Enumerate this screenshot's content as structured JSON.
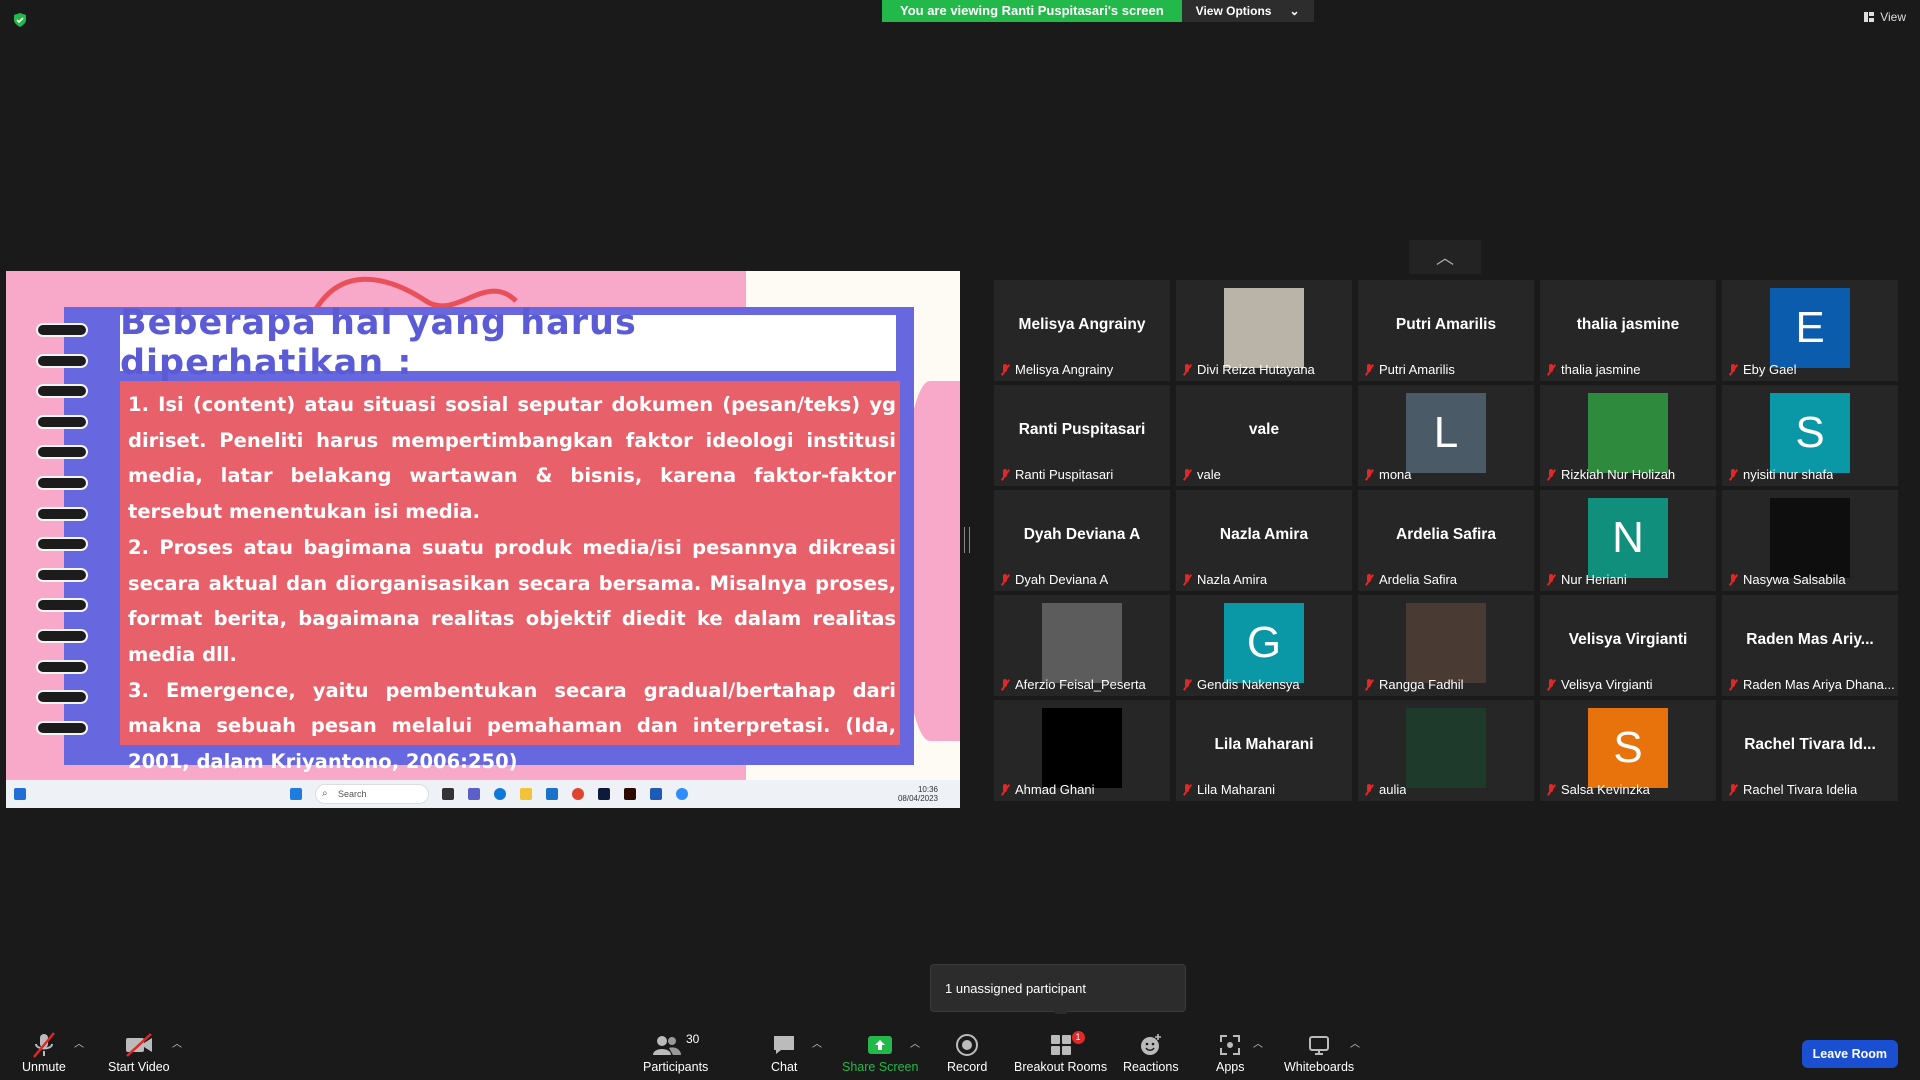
{
  "top": {
    "viewing_text": "You are viewing Ranti Puspitasari's screen",
    "view_options": "View Options",
    "view_label": "View"
  },
  "slide": {
    "title": "Beberapa hal yang harus diperhatikan :",
    "points": [
      " 1. Isi (content) atau situasi sosial seputar dokumen (pesan/teks) yg diriset. Peneliti harus mempertimbangkan faktor ideologi institusi media, latar belakang wartawan & bisnis, karena faktor-faktor tersebut menentukan isi media.",
      "2. Proses atau bagimana suatu produk media/isi pesannya dikreasi secara aktual dan diorganisasikan secara bersama. Misalnya proses, format berita, bagaimana realitas objektif diedit ke dalam realitas media dll.",
      "3. Emergence, yaitu pembentukan secara gradual/bertahap dari makna sebuah pesan melalui pemahaman dan interpretasi. (Ida, 2001, dalam Kriyantono, 2006:250)"
    ],
    "taskbar": {
      "search": "Search",
      "time": "10:36",
      "date": "08/04/2023"
    }
  },
  "participants": [
    {
      "center": "Melisya Angrainy",
      "name": "Melisya Angrainy",
      "kind": "text"
    },
    {
      "center": "",
      "name": "Divi Reiza Hutayana",
      "kind": "photo",
      "color": "#b9b3a8"
    },
    {
      "center": "Putri Amarilis",
      "name": "Putri Amarilis",
      "kind": "text"
    },
    {
      "center": "thalia jasmine",
      "name": "thalia jasmine",
      "kind": "text"
    },
    {
      "center": "E",
      "name": "Eby Gael",
      "kind": "letter",
      "color": "#0b5cad"
    },
    {
      "center": "Ranti Puspitasari",
      "name": "Ranti Puspitasari",
      "kind": "text"
    },
    {
      "center": "vale",
      "name": "vale",
      "kind": "text"
    },
    {
      "center": "L",
      "name": "mona",
      "kind": "letter",
      "color": "#4a5a66"
    },
    {
      "center": "",
      "name": "Rizkiah Nur Holizah",
      "kind": "photo",
      "color": "#2e8b3e"
    },
    {
      "center": "S",
      "name": "nyisiti nur shafa",
      "kind": "letter",
      "color": "#0a97a6"
    },
    {
      "center": "Dyah Deviana A",
      "name": "Dyah Deviana A",
      "kind": "text"
    },
    {
      "center": "Nazla Amira",
      "name": "Nazla Amira",
      "kind": "text"
    },
    {
      "center": "Ardelia Safira",
      "name": "Ardelia Safira",
      "kind": "text"
    },
    {
      "center": "N",
      "name": "Nur Heriani",
      "kind": "letter",
      "color": "#0f8f7c"
    },
    {
      "center": "",
      "name": "Nasywa Salsabila",
      "kind": "photo",
      "color": "#0e0e0e"
    },
    {
      "center": "",
      "name": "Aferzio Feisal_Peserta",
      "kind": "photo",
      "color": "#5c5c5c"
    },
    {
      "center": "G",
      "name": "Gendis Nakensya",
      "kind": "letter",
      "color": "#0a97a6"
    },
    {
      "center": "",
      "name": "Rangga Fadhil",
      "kind": "photo",
      "color": "#4a3a34"
    },
    {
      "center": "Velisya Virgianti",
      "name": "Velisya Virgianti",
      "kind": "text"
    },
    {
      "center": "Raden Mas Ariy...",
      "name": "Raden Mas Ariya Dhana...",
      "kind": "text"
    },
    {
      "center": "",
      "name": "Ahmad Ghani",
      "kind": "photo",
      "color": "#000000"
    },
    {
      "center": "Lila Maharani",
      "name": "Lila Maharani",
      "kind": "text"
    },
    {
      "center": "",
      "name": "aulia",
      "kind": "photo",
      "color": "#1e3a2a"
    },
    {
      "center": "S",
      "name": "Salsa Kevinzka",
      "kind": "letter",
      "color": "#e8720c"
    },
    {
      "center": "Rachel Tivara Id...",
      "name": "Rachel Tivara Idelia",
      "kind": "text"
    }
  ],
  "tooltip": "1 unassigned participant",
  "toolbar": {
    "unmute": "Unmute",
    "start_video": "Start Video",
    "participants": "Participants",
    "participants_count": "30",
    "chat": "Chat",
    "share_screen": "Share Screen",
    "record": "Record",
    "breakout": "Breakout Rooms",
    "breakout_badge": "1",
    "reactions": "Reactions",
    "apps": "Apps",
    "whiteboards": "Whiteboards",
    "leave": "Leave Room"
  },
  "colors": {
    "share_green": "#23b84a",
    "leave_blue": "#1a4fd1",
    "muted_red": "#e02828",
    "slide_pink": "#f8a9c9",
    "slide_purple": "#6767e0",
    "slide_red": "#e8606a"
  }
}
